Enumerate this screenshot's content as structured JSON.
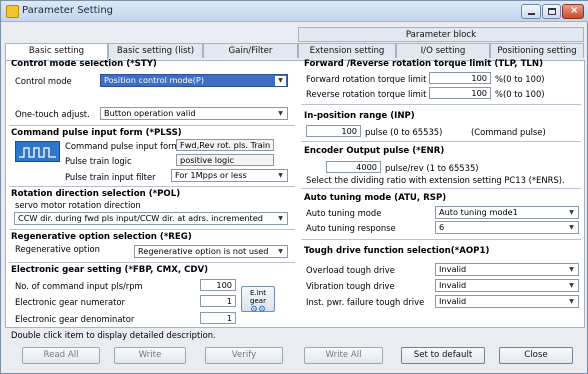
{
  "window": {
    "title": "Parameter Setting"
  },
  "tabs": {
    "row1": [
      "Parameter block"
    ],
    "row2": [
      "Basic setting",
      "Basic setting (list)",
      "Gain/Filter",
      "Extension setting",
      "I/O setting",
      "Positioning setting"
    ]
  },
  "control_mode": {
    "title": "Control mode selection (*STY)",
    "label": "Control mode",
    "value": "Position control mode(P)",
    "one_touch_label": "One-touch adjust.",
    "one_touch_value": "Button operation valid"
  },
  "pulse_input": {
    "title": "Command pulse input form (*PLSS)",
    "form_label": "Command pulse input form",
    "form_value": "Fwd,Rev rot. pls. Train",
    "logic_label": "Pulse train logic",
    "logic_value": "positive logic",
    "filter_label": "Pulse train input filter",
    "filter_value": "For 1Mpps or less"
  },
  "rotation": {
    "title": "Rotation direction selection (*POL)",
    "sub": "servo motor rotation direction",
    "value": "CCW dir. during fwd pls input/CCW dir. at adrs. incremented"
  },
  "regen": {
    "title": "Regenerative option selection (*REG)",
    "label": "Regenerative option",
    "value": "Regenerative option is not used"
  },
  "gear": {
    "title": "Electronic gear setting (*FBP, CMX, CDV)",
    "pls_label": "No. of command input pls/rpm",
    "pls_value": "100",
    "num_label": "Electronic gear numerator",
    "num_value": "1",
    "den_label": "Electronic gear denominator",
    "den_value": "1",
    "btn_label": "E.Int gear"
  },
  "torque": {
    "title": "Forward /Reverse rotation torque limit (TLP, TLN)",
    "fwd_label": "Forward rotation torque limit",
    "fwd_value": "100",
    "fwd_unit": "%(0 to 100)",
    "rev_label": "Reverse rotation torque limit",
    "rev_value": "100",
    "rev_unit": "%(0 to 100)"
  },
  "inpos": {
    "title": "In-position range (INP)",
    "value": "100",
    "unit": "pulse (0 to 65535)",
    "note": "(Command pulse)"
  },
  "encoder": {
    "title": "Encoder Output pulse (*ENR)",
    "value": "4000",
    "unit": "pulse/rev (1 to 65535)",
    "note": "Select the dividing ratio with extension setting PC13 (*ENRS)."
  },
  "autotune": {
    "title": "Auto tuning mode (ATU, RSP)",
    "mode_label": "Auto tuning mode",
    "mode_value": "Auto tuning mode1",
    "resp_label": "Auto tuning response",
    "resp_value": "6"
  },
  "tough": {
    "title": "Tough drive function selection(*AOP1)",
    "overload_label": "Overload tough drive",
    "overload_value": "Invalid",
    "vib_label": "Vibration tough drive",
    "vib_value": "Invalid",
    "inst_label": "Inst. pwr. failure tough drive",
    "inst_value": "Invalid"
  },
  "status": {
    "text": "Double click item to display detailed description."
  },
  "buttons": {
    "read_all": "Read All",
    "write": "Write",
    "verify": "Verify",
    "write_all": "Write All",
    "set_default": "Set to default",
    "close": "Close"
  }
}
